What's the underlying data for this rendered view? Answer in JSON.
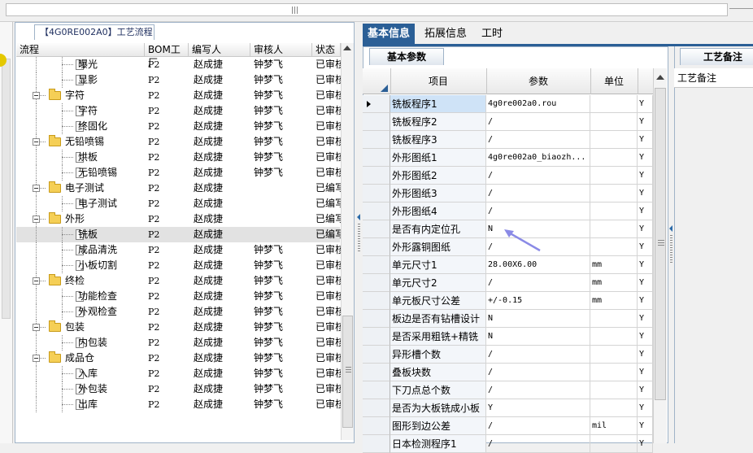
{
  "tree_panel": {
    "tab_title": "【4G0RE002A0】工艺流程",
    "columns": [
      "流程",
      "BOM工厂",
      "编写人",
      "审核人",
      "状态"
    ],
    "rows": [
      {
        "name": "曝光",
        "kind": "leaf",
        "bom": "P2",
        "author": "赵成捷",
        "reviewer": "钟梦飞",
        "status": "已审核"
      },
      {
        "name": "显影",
        "kind": "leaf",
        "bom": "P2",
        "author": "赵成捷",
        "reviewer": "钟梦飞",
        "status": "已审核"
      },
      {
        "name": "字符",
        "kind": "folder",
        "bom": "P2",
        "author": "赵成捷",
        "reviewer": "钟梦飞",
        "status": "已审核"
      },
      {
        "name": "字符",
        "kind": "leaf",
        "bom": "P2",
        "author": "赵成捷",
        "reviewer": "钟梦飞",
        "status": "已审核"
      },
      {
        "name": "终固化",
        "kind": "leaf",
        "bom": "P2",
        "author": "赵成捷",
        "reviewer": "钟梦飞",
        "status": "已审核"
      },
      {
        "name": "无铅喷锡",
        "kind": "folder",
        "bom": "P2",
        "author": "赵成捷",
        "reviewer": "钟梦飞",
        "status": "已审核"
      },
      {
        "name": "烘板",
        "kind": "leaf",
        "bom": "P2",
        "author": "赵成捷",
        "reviewer": "钟梦飞",
        "status": "已审核"
      },
      {
        "name": "无铅喷锡",
        "kind": "leaf",
        "bom": "P2",
        "author": "赵成捷",
        "reviewer": "钟梦飞",
        "status": "已审核"
      },
      {
        "name": "电子测试",
        "kind": "folder",
        "bom": "P2",
        "author": "赵成捷",
        "reviewer": "",
        "status": "已编写"
      },
      {
        "name": "电子测试",
        "kind": "leaf",
        "bom": "P2",
        "author": "赵成捷",
        "reviewer": "",
        "status": "已编写"
      },
      {
        "name": "外形",
        "kind": "folder",
        "bom": "P2",
        "author": "赵成捷",
        "reviewer": "",
        "status": "已编写"
      },
      {
        "name": "铣板",
        "kind": "leaf",
        "bom": "P2",
        "author": "赵成捷",
        "reviewer": "",
        "status": "已编写",
        "selected": true
      },
      {
        "name": "成品清洗",
        "kind": "leaf",
        "bom": "P2",
        "author": "赵成捷",
        "reviewer": "钟梦飞",
        "status": "已审核"
      },
      {
        "name": "小板切割",
        "kind": "leaf",
        "bom": "P2",
        "author": "赵成捷",
        "reviewer": "钟梦飞",
        "status": "已审核"
      },
      {
        "name": "终检",
        "kind": "folder",
        "bom": "P2",
        "author": "赵成捷",
        "reviewer": "钟梦飞",
        "status": "已审核"
      },
      {
        "name": "功能检查",
        "kind": "leaf",
        "bom": "P2",
        "author": "赵成捷",
        "reviewer": "钟梦飞",
        "status": "已审核"
      },
      {
        "name": "外观检查",
        "kind": "leaf",
        "bom": "P2",
        "author": "赵成捷",
        "reviewer": "钟梦飞",
        "status": "已审核"
      },
      {
        "name": "包装",
        "kind": "folder",
        "bom": "P2",
        "author": "赵成捷",
        "reviewer": "钟梦飞",
        "status": "已审核"
      },
      {
        "name": "内包装",
        "kind": "leaf",
        "bom": "P2",
        "author": "赵成捷",
        "reviewer": "钟梦飞",
        "status": "已审核"
      },
      {
        "name": "成品仓",
        "kind": "folder",
        "bom": "P2",
        "author": "赵成捷",
        "reviewer": "钟梦飞",
        "status": "已审核"
      },
      {
        "name": "入库",
        "kind": "leaf",
        "bom": "P2",
        "author": "赵成捷",
        "reviewer": "钟梦飞",
        "status": "已审核"
      },
      {
        "name": "外包装",
        "kind": "leaf",
        "bom": "P2",
        "author": "赵成捷",
        "reviewer": "钟梦飞",
        "status": "已审核"
      },
      {
        "name": "出库",
        "kind": "leaf",
        "bom": "P2",
        "author": "赵成捷",
        "reviewer": "钟梦飞",
        "status": "已审核"
      }
    ]
  },
  "tabs": [
    {
      "label": "基本信息",
      "active": true
    },
    {
      "label": "拓展信息",
      "active": false
    },
    {
      "label": "工时",
      "active": false
    }
  ],
  "params_panel": {
    "tab_title": "基本参数",
    "columns": [
      "项目",
      "参数",
      "单位"
    ],
    "rows": [
      {
        "item": "铣板程序1",
        "value": "4g0re002a0.rou",
        "unit": "",
        "flag": "Y",
        "current": true
      },
      {
        "item": "铣板程序2",
        "value": "/",
        "unit": "",
        "flag": "Y"
      },
      {
        "item": "铣板程序3",
        "value": "/",
        "unit": "",
        "flag": "Y"
      },
      {
        "item": "外形图纸1",
        "value": "4g0re002a0_biaozh...",
        "unit": "",
        "flag": "Y"
      },
      {
        "item": "外形图纸2",
        "value": "/",
        "unit": "",
        "flag": "Y"
      },
      {
        "item": "外形图纸3",
        "value": "/",
        "unit": "",
        "flag": "Y"
      },
      {
        "item": "外形图纸4",
        "value": "/",
        "unit": "",
        "flag": "Y"
      },
      {
        "item": "是否有内定位孔",
        "value": "N",
        "unit": "",
        "flag": "Y"
      },
      {
        "item": "外形露铜图纸",
        "value": "/",
        "unit": "",
        "flag": "Y"
      },
      {
        "item": "单元尺寸1",
        "value": "28.00X6.00",
        "unit": "mm",
        "flag": "Y"
      },
      {
        "item": "单元尺寸2",
        "value": "/",
        "unit": "mm",
        "flag": "Y"
      },
      {
        "item": "单元板尺寸公差",
        "value": "+/-0.15",
        "unit": "mm",
        "flag": "Y"
      },
      {
        "item": "板边是否有钻槽设计",
        "value": "N",
        "unit": "",
        "flag": "Y"
      },
      {
        "item": "是否采用粗铣+精铣",
        "value": "N",
        "unit": "",
        "flag": "Y"
      },
      {
        "item": "异形槽个数",
        "value": "/",
        "unit": "",
        "flag": "Y"
      },
      {
        "item": "叠板块数",
        "value": "/",
        "unit": "",
        "flag": "Y"
      },
      {
        "item": "下刀点总个数",
        "value": "/",
        "unit": "",
        "flag": "Y"
      },
      {
        "item": "是否为大板铣成小板",
        "value": "Y",
        "unit": "",
        "flag": "Y"
      },
      {
        "item": "图形到边公差",
        "value": "/",
        "unit": "mil",
        "flag": "Y"
      },
      {
        "item": "日本检测程序1",
        "value": "/",
        "unit": "",
        "flag": "Y"
      }
    ]
  },
  "notes_panel": {
    "tab_title": "工艺备注",
    "header": "工艺备注"
  },
  "colors": {
    "accent": "#2b5f96",
    "selected_item": "#cfe3f7",
    "annotation_arrow": "#8a8ae6"
  },
  "icons": [
    "folder-icon",
    "document-icon",
    "collapse-minus-icon",
    "row-pointer-icon",
    "scroll-up-arrow-icon",
    "splitter-arrow-icon"
  ]
}
